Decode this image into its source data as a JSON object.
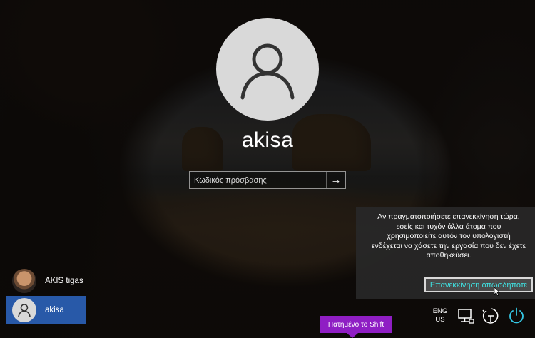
{
  "login": {
    "username": "akisa",
    "password_placeholder": "Κωδικός πρόσβασης"
  },
  "restart_panel": {
    "message": "Αν πραγματοποιήσετε επανεκκίνηση τώρα,\nεσείς και τυχόν άλλα άτομα που\nχρησιμοποιείτε αυτόν τον υπολογιστή\nενδέχεται να χάσετε την εργασία που δεν έχετε\nαποθηκεύσει.",
    "button_label": "Επανεκκίνηση οπωσδήποτε"
  },
  "users": [
    {
      "name": "AKIS tigas"
    },
    {
      "name": "akisa"
    }
  ],
  "overlay": {
    "shift_label": "Πατημένο το Shift"
  },
  "tray": {
    "language_line1": "ENG",
    "language_line2": "US",
    "icons": [
      "network-icon",
      "ease-of-access-icon",
      "power-icon"
    ]
  },
  "colors": {
    "selected_user_bg": "#2859a8",
    "accent_text": "#3fe0e0",
    "shift_label_bg": "#8f1ec4"
  }
}
